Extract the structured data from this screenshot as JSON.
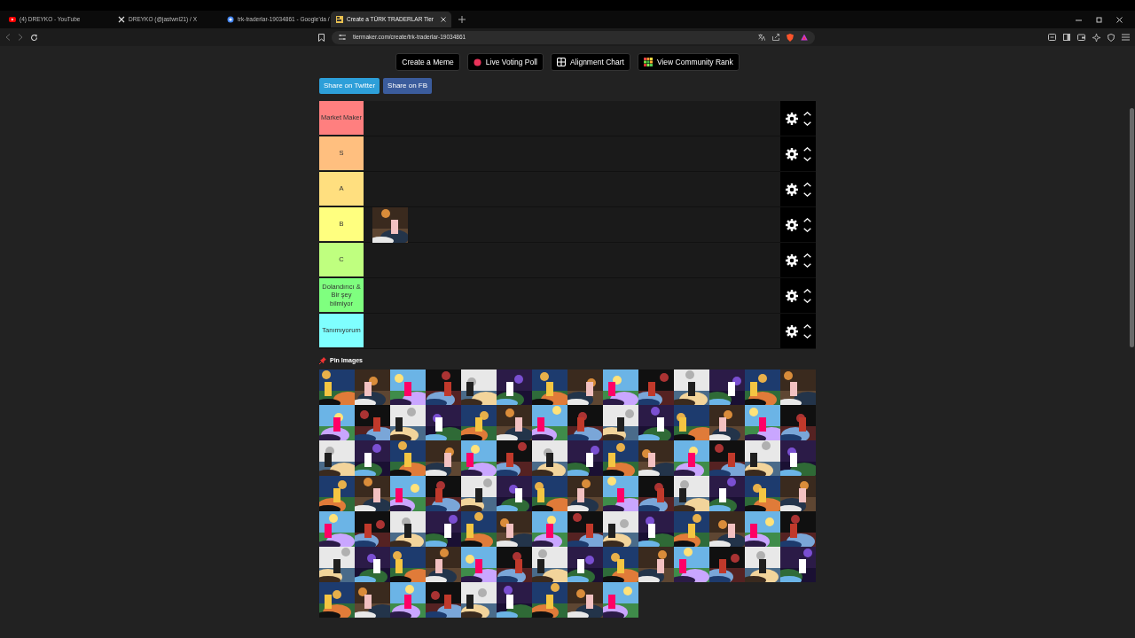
{
  "browser": {
    "tabs": [
      {
        "title": "(4) DREYKO - YouTube",
        "kind": "youtube",
        "selected": false
      },
      {
        "title": "DREYKO (@jastwnl21) / X",
        "kind": "x",
        "selected": false
      },
      {
        "title": "trk-traderlar-19034861 - Google'da /",
        "kind": "google",
        "selected": false
      },
      {
        "title": "Create a TÜRK TRADERLAR Tier",
        "kind": "tiermaker",
        "selected": true
      }
    ],
    "address": "tiermaker.com/create/trk-traderlar-19034861"
  },
  "toolbar_buttons": [
    {
      "label": "Create a Meme",
      "kind": "plain"
    },
    {
      "label": "Live Voting Poll",
      "kind": "dot"
    },
    {
      "label": "Alignment Chart",
      "kind": "grid"
    },
    {
      "label": "View Community Rank",
      "kind": "mosaic"
    }
  ],
  "share_buttons": [
    {
      "label": "Share on Twitter",
      "kind": "twitter"
    },
    {
      "label": "Share on FB",
      "kind": "facebook"
    }
  ],
  "tiers": [
    {
      "label": "Market Maker",
      "color": "#ff7f7f"
    },
    {
      "label": "S",
      "color": "#ffbf7f"
    },
    {
      "label": "A",
      "color": "#ffdf7f"
    },
    {
      "label": "B",
      "color": "#ffff7f"
    },
    {
      "label": "C",
      "color": "#bfff7f"
    },
    {
      "label": "Dolandırıcı & Bir şey bilmiyor",
      "color": "#7fff7f"
    },
    {
      "label": "Tanımıyorum",
      "color": "#7fffff"
    }
  ],
  "pin_images": {
    "label": "Pin Images"
  }
}
